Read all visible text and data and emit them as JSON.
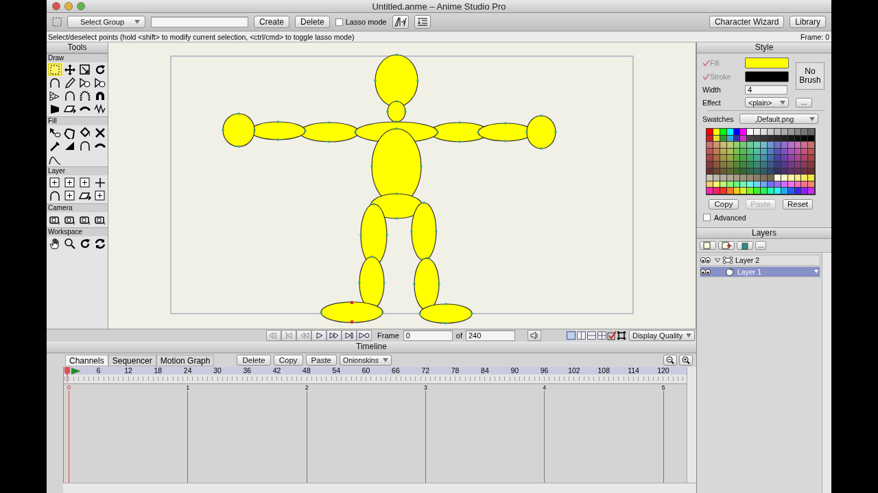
{
  "window": {
    "title": "Untitled.anme – Anime Studio Pro"
  },
  "toolbar": {
    "group_select": "Select Group",
    "buttons": [
      "Create",
      "Delete"
    ],
    "lasso_mode": {
      "label": "Lasso mode",
      "checked": false
    },
    "right_buttons": [
      "Character Wizard",
      "Library"
    ]
  },
  "hint": "Select/deselect points (hold <shift> to modify current selection, <ctrl/cmd> to toggle lasso mode)",
  "frame_status": "Frame: 0",
  "tools": {
    "title": "Tools",
    "sections": [
      {
        "label": "Draw",
        "tools": [
          {
            "selected": true
          },
          {
            "selected": false
          },
          {
            "selected": false
          },
          {
            "selected": false
          },
          {
            "selected": false
          },
          {
            "selected": false
          },
          {
            "selected": false
          },
          {
            "selected": false
          },
          {
            "selected": false
          },
          {
            "selected": false
          },
          {
            "selected": false
          },
          {
            "selected": false
          },
          {
            "selected": false
          },
          {
            "selected": false
          },
          {
            "selected": false
          },
          {
            "selected": false
          }
        ]
      },
      {
        "label": "Fill",
        "tools": [
          {
            "selected": false
          },
          {
            "selected": false
          },
          {
            "selected": false
          },
          {
            "selected": false
          },
          {
            "selected": false
          },
          {
            "selected": false
          },
          {
            "selected": false
          },
          {
            "selected": false
          },
          {
            "selected": false
          }
        ]
      },
      {
        "label": "Layer",
        "tools": [
          {
            "selected": false
          },
          {
            "selected": false
          },
          {
            "selected": false
          },
          {
            "selected": false
          },
          {
            "selected": false
          },
          {
            "selected": false
          },
          {
            "selected": false
          },
          {
            "selected": false
          }
        ]
      },
      {
        "label": "Camera",
        "tools": [
          {
            "selected": false
          },
          {
            "selected": false
          },
          {
            "selected": false
          },
          {
            "selected": false
          }
        ]
      },
      {
        "label": "Workspace",
        "tools": [
          {
            "selected": false
          },
          {
            "selected": false
          },
          {
            "selected": false
          },
          {
            "selected": false
          }
        ]
      }
    ]
  },
  "playback": {
    "frame_label": "Frame",
    "frame_value": "0",
    "of_label": "of",
    "total": "240",
    "view_modes": [
      {
        "selected": true
      },
      {
        "selected": false
      },
      {
        "selected": false
      },
      {
        "selected": false
      }
    ],
    "display_quality": "Display Quality"
  },
  "timeline": {
    "title": "Timeline",
    "tabs": [
      {
        "label": "Channels",
        "selected": true
      },
      {
        "label": "Sequencer",
        "selected": false
      },
      {
        "label": "Motion Graph",
        "selected": false
      }
    ],
    "buttons": [
      "Delete",
      "Copy",
      "Paste"
    ],
    "onionskins": "Onionskins",
    "ruler": [
      "6",
      "12",
      "18",
      "24",
      "30",
      "36",
      "42",
      "48",
      "54",
      "60",
      "66",
      "72",
      "78",
      "84",
      "90",
      "96",
      "102",
      "108",
      "114",
      "120"
    ],
    "tracks": [
      "0",
      "1",
      "2",
      "3",
      "4",
      "5"
    ]
  },
  "style": {
    "title": "Style",
    "fill": {
      "label": "Fill",
      "checked": true,
      "color": "#ffff00"
    },
    "stroke": {
      "label": "Stroke",
      "checked": true,
      "color": "#000000"
    },
    "width": {
      "label": "Width",
      "value": "4"
    },
    "effect": {
      "label": "Effect",
      "value": "<plain>"
    },
    "more": "...",
    "brush": "No Brush",
    "swatches": {
      "label": "Swatches",
      "value": ",Default.png"
    },
    "buttons": [
      {
        "label": "Copy",
        "disabled": false
      },
      {
        "label": "Paste",
        "disabled": true
      },
      {
        "label": "Reset",
        "disabled": false
      }
    ],
    "advanced": {
      "label": "Advanced",
      "checked": false
    }
  },
  "layers": {
    "title": "Layers",
    "more": "...",
    "items": [
      {
        "name": "Layer 2",
        "kind": "group",
        "expanded": true,
        "selected": false,
        "children": [
          {
            "name": "Layer 1",
            "kind": "vector",
            "selected": true
          }
        ]
      }
    ]
  }
}
